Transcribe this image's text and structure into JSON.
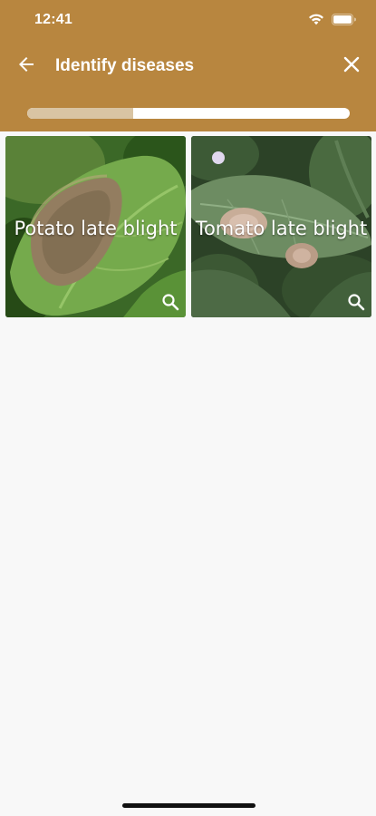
{
  "status_bar": {
    "time": "12:41",
    "icons": [
      "wifi-icon",
      "battery-icon"
    ]
  },
  "toolbar": {
    "back_icon": "arrow-left-icon",
    "title": "Identify diseases",
    "close_icon": "close-icon"
  },
  "progress": {
    "fraction": 0.33
  },
  "results": [
    {
      "label": "Potato late blight",
      "action_icon": "magnify-icon"
    },
    {
      "label": "Tomato late blight",
      "action_icon": "magnify-icon"
    }
  ],
  "colors": {
    "header": "#b8863f",
    "progress_fill": "#d9c4a3",
    "progress_track": "#ffffff",
    "background": "#f8f8f8"
  }
}
